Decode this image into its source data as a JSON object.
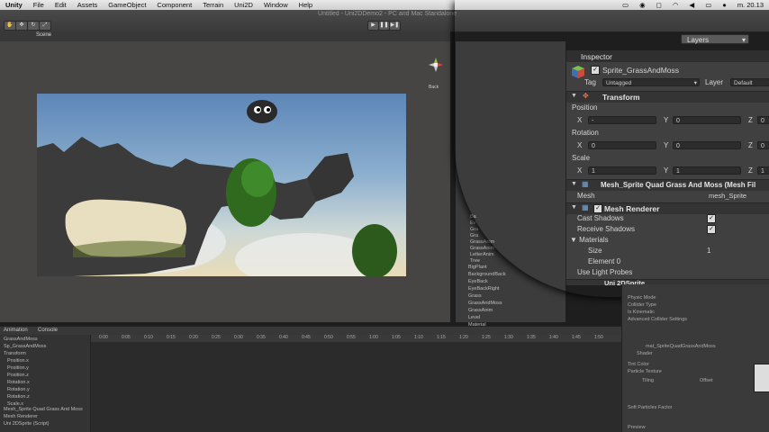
{
  "menubar": {
    "items": [
      "Unity",
      "File",
      "Edit",
      "Assets",
      "GameObject",
      "Component",
      "Terrain",
      "Uni2D",
      "Window",
      "Help"
    ],
    "clock": "m. 20.13"
  },
  "window": {
    "title": "Untitled - Uni2DDemo2 - PC and Mac Standalone"
  },
  "toolbar": {
    "layers_label": "Layers"
  },
  "scene": {
    "tab_label": "Scene",
    "gizmo_label": "Back"
  },
  "hierarchy": {
    "items": [
      "Ba",
      "Ev",
      "Gra",
      "Gra",
      "GrassAnim",
      "GrassAnim",
      "LetterAnim",
      "Tree",
      "BigPlant",
      "BackgroundBack",
      "EyeBack",
      "EyeBackRight",
      "Grass",
      "GrassAndMoss",
      "GrassAnim",
      "Level",
      "Material"
    ]
  },
  "inspector": {
    "tab_label": "Inspector",
    "object_name": "Sprite_GrassAndMoss",
    "tag_label": "Tag",
    "tag_value": "Untagged",
    "layer_label": "Layer",
    "layer_value": "Default",
    "transform": {
      "title": "Transform",
      "position_label": "Position",
      "rotation_label": "Rotation",
      "scale_label": "Scale",
      "position": {
        "x": "-",
        "y": "0",
        "z": "0"
      },
      "rotation": {
        "x": "0",
        "y": "0",
        "z": "0"
      },
      "scale": {
        "x": "1",
        "y": "1",
        "z": "1"
      },
      "axis_x": "X",
      "axis_y": "Y",
      "axis_z": "Z"
    },
    "mesh_filter": {
      "title": "Mesh_Sprite Quad Grass And Moss (Mesh Fil",
      "mesh_label": "Mesh",
      "mesh_value": "mesh_Sprite"
    },
    "mesh_renderer": {
      "title": "Mesh Renderer",
      "cast_shadows": "Cast Shadows",
      "receive_shadows": "Receive Shadows",
      "materials": "Materials",
      "size_label": "Size",
      "size_value": "1",
      "element0": "Element 0",
      "light_probes": "Use Light Probes"
    },
    "sprite": {
      "title": "Uni 2DSprite"
    }
  },
  "animation": {
    "tabs": [
      "Animation",
      "Console"
    ],
    "clip": "GrassAndMoss",
    "props": [
      "Sp_GrassAndMoss",
      "Transform",
      "Position.x",
      "Position.y",
      "Position.z",
      "Rotation.x",
      "Rotation.y",
      "Rotation.z",
      "Scale.x",
      "Scale.y",
      "Scale.z",
      "Mesh_Sprite Quad Grass And Moss",
      "Mesh Renderer",
      "Uni 2DSprite (Script)"
    ],
    "ticks": [
      "0:00",
      "0:05",
      "0:10",
      "0:15",
      "0:20",
      "0:25",
      "0:30",
      "0:35",
      "0:40",
      "0:45",
      "0:50",
      "0:55",
      "1:00",
      "1:05",
      "1:10",
      "1:15",
      "1:20",
      "1:25",
      "1:30",
      "1:35",
      "1:40",
      "1:45",
      "1:50"
    ]
  },
  "lower_inspector": {
    "items": [
      "Physic Mode",
      "Collider Type",
      "Is Kinematic",
      "Advanced Collider Settings",
      "mat_SpriteQuadGrassAndMoss",
      "Shader",
      "Tint Color",
      "Particle Texture",
      "Tiling",
      "Offset",
      "Soft Particles Factor",
      "Preview"
    ]
  },
  "colors": {
    "accent_blue": "#3d6fb4",
    "panel_dark": "#404040"
  }
}
